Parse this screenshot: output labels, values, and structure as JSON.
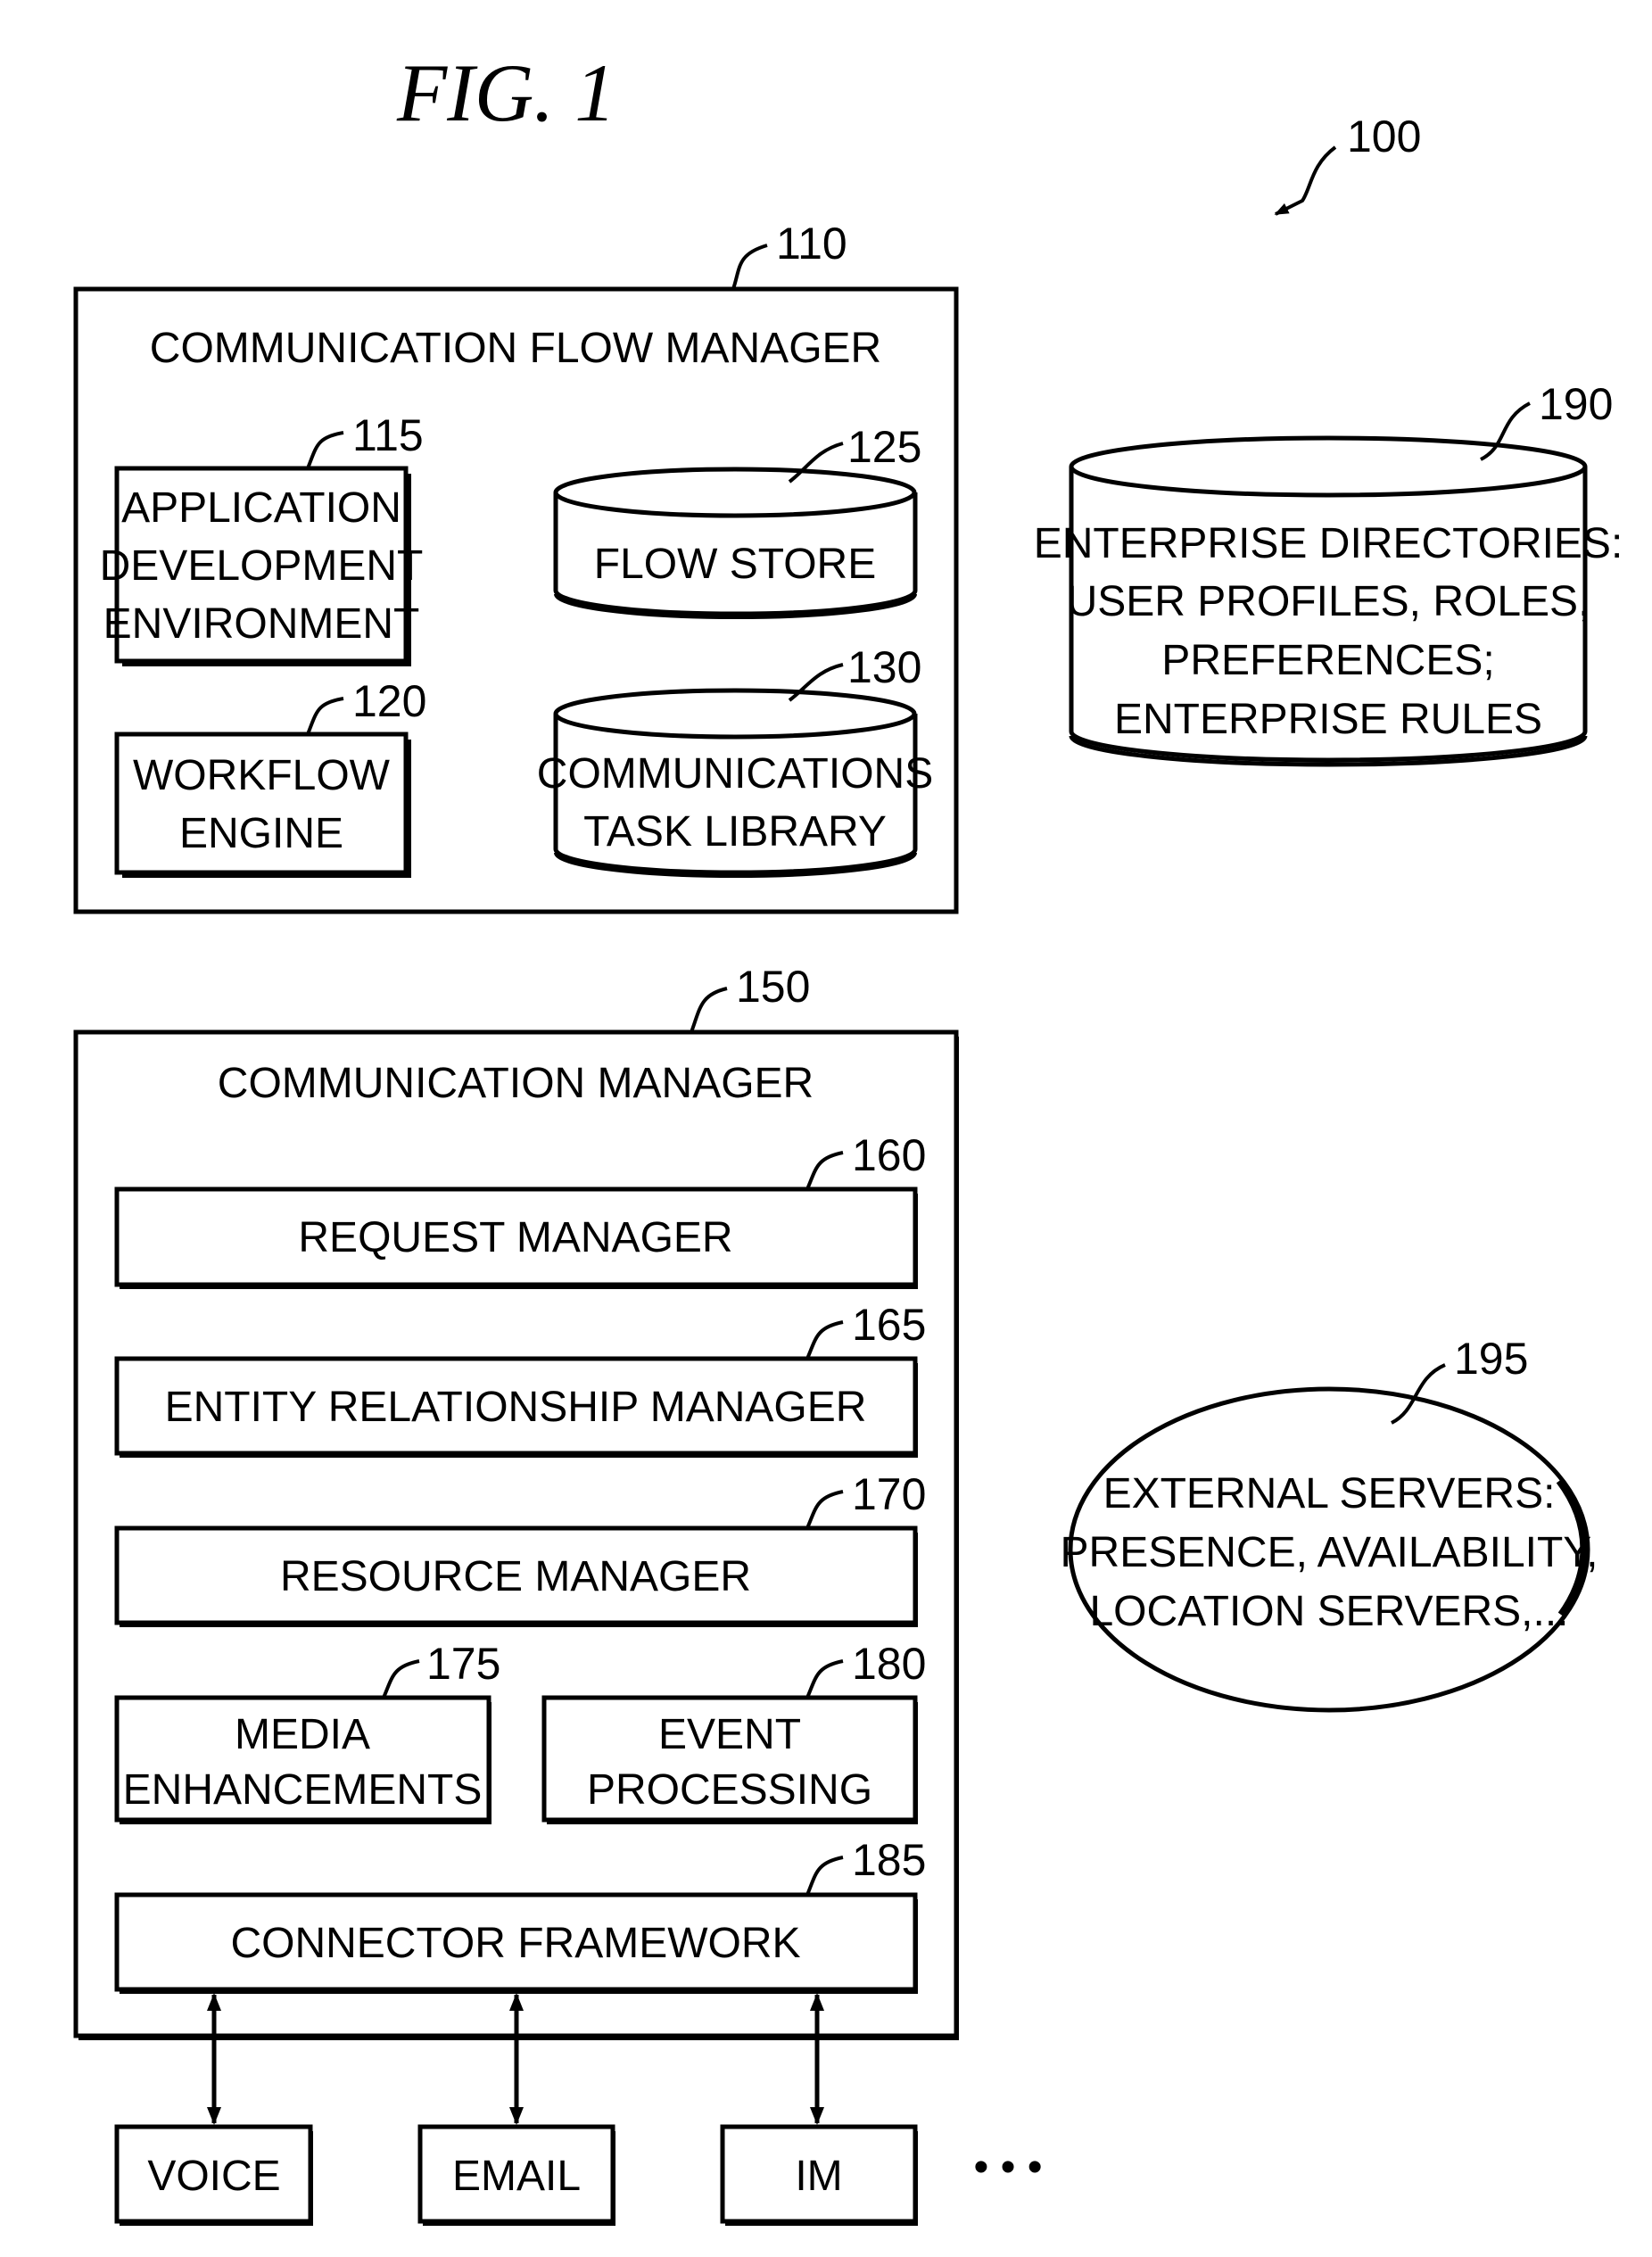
{
  "figure": {
    "title": "FIG.  1",
    "system_ref": "100"
  },
  "flow_manager": {
    "ref": "110",
    "title": "COMMUNICATION FLOW MANAGER",
    "components": [
      {
        "ref": "115",
        "lines": [
          "APPLICATION",
          "DEVELOPMENT",
          "ENVIRONMENT"
        ],
        "shape": "box"
      },
      {
        "ref": "120",
        "lines": [
          "WORKFLOW",
          "ENGINE"
        ],
        "shape": "box"
      },
      {
        "ref": "125",
        "lines": [
          "FLOW STORE"
        ],
        "shape": "cylinder"
      },
      {
        "ref": "130",
        "lines": [
          "COMMUNICATIONS",
          "TASK LIBRARY"
        ],
        "shape": "cylinder"
      }
    ]
  },
  "enterprise_directories": {
    "ref": "190",
    "shape": "cylinder",
    "lines": [
      "ENTERPRISE DIRECTORIES:",
      "USER PROFILES, ROLES,",
      "PREFERENCES;",
      "ENTERPRISE RULES"
    ]
  },
  "communication_manager": {
    "ref": "150",
    "title": "COMMUNICATION MANAGER",
    "components": [
      {
        "ref": "160",
        "lines": [
          "REQUEST MANAGER"
        ]
      },
      {
        "ref": "165",
        "lines": [
          "ENTITY RELATIONSHIP MANAGER"
        ]
      },
      {
        "ref": "170",
        "lines": [
          "RESOURCE MANAGER"
        ]
      },
      {
        "ref": "175",
        "lines": [
          "MEDIA",
          "ENHANCEMENTS"
        ]
      },
      {
        "ref": "180",
        "lines": [
          "EVENT",
          "PROCESSING"
        ]
      },
      {
        "ref": "185",
        "lines": [
          "CONNECTOR FRAMEWORK"
        ]
      }
    ]
  },
  "external_servers": {
    "ref": "195",
    "shape": "ellipse",
    "lines": [
      "EXTERNAL SERVERS:",
      "PRESENCE, AVAILABILITY,",
      "LOCATION SERVERS,..."
    ]
  },
  "channels": {
    "items": [
      "VOICE",
      "EMAIL",
      "IM"
    ],
    "more": "• • •"
  }
}
